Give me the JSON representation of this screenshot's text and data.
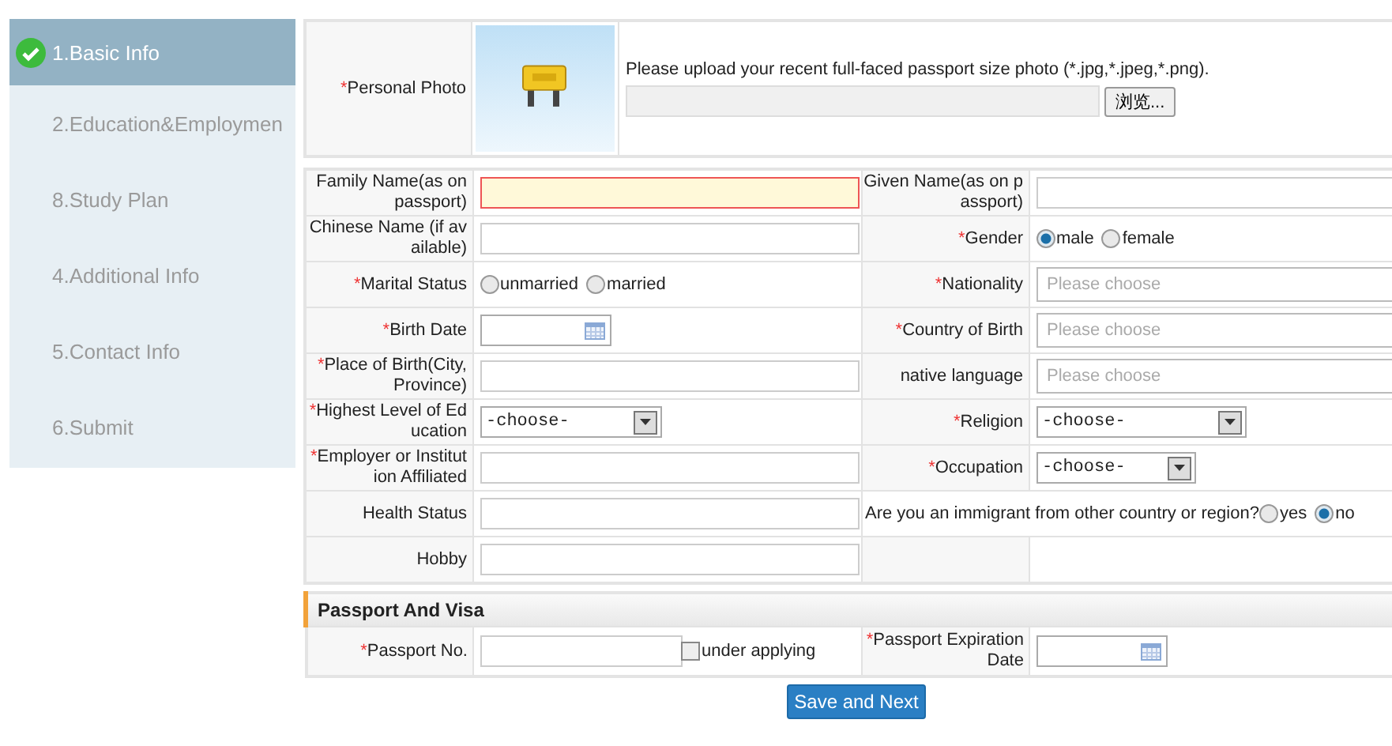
{
  "sidebar": {
    "steps": [
      {
        "label": "1.Basic Info",
        "selected": true,
        "completed": true
      },
      {
        "label": "2.Education&Employmen",
        "selected": false,
        "completed": false
      },
      {
        "label": "8.Study Plan",
        "selected": false,
        "completed": false
      },
      {
        "label": "4.Additional Info",
        "selected": false,
        "completed": false
      },
      {
        "label": "5.Contact Info",
        "selected": false,
        "completed": false
      },
      {
        "label": "6.Submit",
        "selected": false,
        "completed": false
      }
    ]
  },
  "photo": {
    "required_mark": "*",
    "label": "Personal Photo",
    "hint": "Please upload your recent full-faced passport size photo (*.jpg,*.jpeg,*.png).",
    "browse_button": "浏览..."
  },
  "form": {
    "rows": [
      {
        "left": {
          "kind": "text",
          "label": "Family Name(as on passport)",
          "invalid": true
        },
        "right": {
          "kind": "text",
          "label": "Given Name(as on passport)",
          "invalid": false
        }
      },
      {
        "left": {
          "kind": "text",
          "label": "Chinese Name (if available)",
          "invalid": false
        },
        "right": {
          "kind": "radio",
          "required_mark": "*",
          "label": "Gender",
          "options": [
            {
              "label": "male",
              "selected": true
            },
            {
              "label": "female",
              "selected": false
            }
          ]
        }
      },
      {
        "left": {
          "kind": "radio",
          "required_mark": "*",
          "label": "Marital Status",
          "options": [
            {
              "label": "unmarried",
              "selected": false
            },
            {
              "label": "married",
              "selected": false
            }
          ]
        },
        "right": {
          "kind": "combo",
          "required_mark": "*",
          "label": "Nationality",
          "placeholder": "Please choose"
        }
      },
      {
        "left": {
          "kind": "date",
          "required_mark": "*",
          "label": "Birth Date"
        },
        "right": {
          "kind": "combo",
          "required_mark": "*",
          "label": "Country of Birth",
          "placeholder": "Please choose"
        }
      },
      {
        "left": {
          "kind": "text",
          "required_mark": "*",
          "label": "Place of Birth(City, Province)",
          "invalid": false
        },
        "right": {
          "kind": "combo",
          "label": "native language",
          "placeholder": "Please choose"
        }
      },
      {
        "left": {
          "kind": "select",
          "required_mark": "*",
          "label": "Highest Level of Education",
          "value": "-choose-"
        },
        "right": {
          "kind": "select",
          "required_mark": "*",
          "label": "Religion",
          "value": "-choose-"
        }
      },
      {
        "left": {
          "kind": "text",
          "required_mark": "*",
          "label": "Employer or Institution Affiliated",
          "invalid": false
        },
        "right": {
          "kind": "select",
          "required_mark": "*",
          "label": "Occupation",
          "value": "-choose-"
        }
      },
      {
        "left": {
          "kind": "text",
          "label": "Health Status",
          "invalid": false
        },
        "right": {
          "kind": "question",
          "label": "Are you an immigrant from other country or region?",
          "options": [
            {
              "label": "yes",
              "selected": false
            },
            {
              "label": "no",
              "selected": true
            }
          ]
        }
      },
      {
        "left": {
          "kind": "text",
          "label": "Hobby",
          "invalid": false
        },
        "right": null
      }
    ]
  },
  "passport": {
    "title": "Passport And Visa",
    "number": {
      "required_mark": "*",
      "label": "Passport No.",
      "checkbox": {
        "label": "under applying",
        "checked": false
      }
    },
    "expiration": {
      "required_mark": "*",
      "label": "Passport Expiration Date"
    }
  },
  "submit_button": "Save and Next"
}
